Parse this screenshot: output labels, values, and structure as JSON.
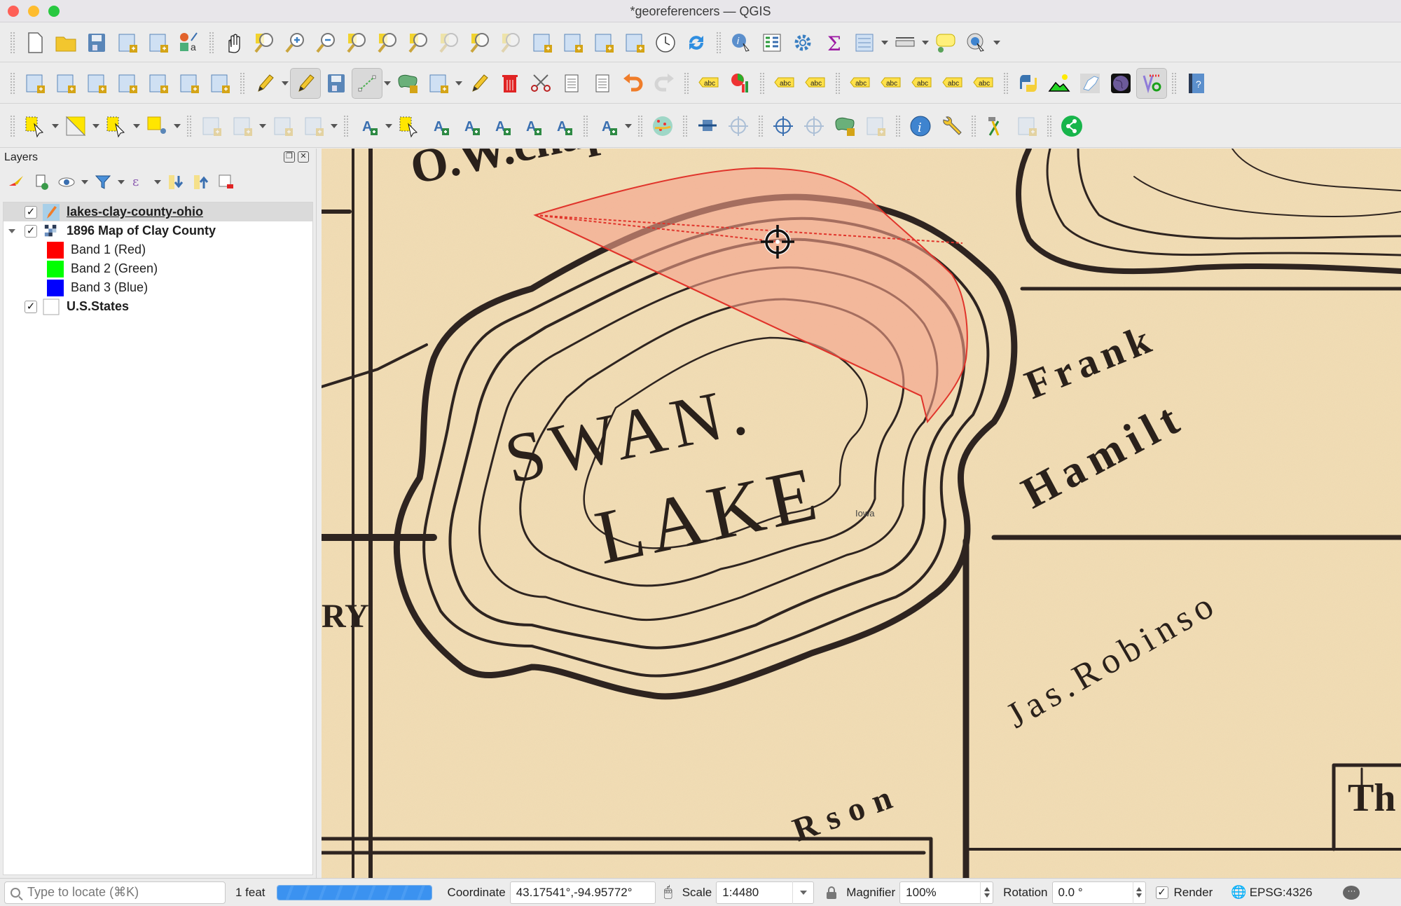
{
  "window": {
    "title": "*georeferencers — QGIS",
    "controls": [
      "close",
      "minimize",
      "maximize"
    ]
  },
  "toolbars": {
    "row1": [
      {
        "icon": "new-project-icon"
      },
      {
        "icon": "open-project-icon"
      },
      {
        "icon": "save-project-icon"
      },
      {
        "icon": "new-print-layout-icon"
      },
      {
        "icon": "layout-manager-icon"
      },
      {
        "icon": "style-manager-icon"
      },
      {
        "icon": "pan-hand-icon"
      },
      {
        "icon": "pan-to-selection-icon"
      },
      {
        "icon": "zoom-in-icon"
      },
      {
        "icon": "zoom-out-icon"
      },
      {
        "icon": "zoom-full-icon"
      },
      {
        "icon": "zoom-to-selection-icon"
      },
      {
        "icon": "zoom-to-layer-icon"
      },
      {
        "icon": "zoom-native-resolution-icon",
        "disabled": true
      },
      {
        "icon": "zoom-last-icon"
      },
      {
        "icon": "zoom-next-icon",
        "disabled": true
      },
      {
        "icon": "new-map-view-icon"
      },
      {
        "icon": "new-3d-map-view-icon"
      },
      {
        "icon": "new-spatial-bookmark-icon"
      },
      {
        "icon": "show-spatial-bookmarks-icon"
      },
      {
        "icon": "temporal-controller-icon"
      },
      {
        "icon": "refresh-icon"
      },
      {
        "icon": "identify-features-icon"
      },
      {
        "icon": "attribute-table-icon"
      },
      {
        "icon": "toolbox-gear-icon"
      },
      {
        "icon": "statistical-summary-icon"
      },
      {
        "icon": "open-field-calculator-icon"
      },
      {
        "icon": "measure-line-icon"
      },
      {
        "icon": "map-tips-icon"
      },
      {
        "icon": "run-action-icon"
      }
    ],
    "row2": [
      {
        "icon": "data-source-manager-icon"
      },
      {
        "icon": "new-geopackage-layer-icon"
      },
      {
        "icon": "new-shapefile-layer-icon"
      },
      {
        "icon": "new-spatialite-layer-icon"
      },
      {
        "icon": "new-temporary-layer-icon"
      },
      {
        "icon": "new-virtual-layer-icon"
      },
      {
        "icon": "new-mesh-layer-icon"
      },
      {
        "icon": "current-edits-icon"
      },
      {
        "icon": "toggle-editing-pencil-icon",
        "active": true
      },
      {
        "icon": "save-layer-edits-icon"
      },
      {
        "icon": "digitize-line-icon",
        "active": true
      },
      {
        "icon": "add-polygon-feature-icon"
      },
      {
        "icon": "vertex-tool-icon"
      },
      {
        "icon": "modify-attributes-icon"
      },
      {
        "icon": "delete-selected-icon"
      },
      {
        "icon": "cut-features-icon"
      },
      {
        "icon": "copy-features-icon"
      },
      {
        "icon": "paste-features-icon"
      },
      {
        "icon": "undo-icon"
      },
      {
        "icon": "redo-icon",
        "disabled": true
      },
      {
        "icon": "label-abc-icon"
      },
      {
        "icon": "diagram-options-icon"
      },
      {
        "icon": "highlight-pinned-labels-icon"
      },
      {
        "icon": "toggle-display-labels-icon"
      },
      {
        "icon": "pin-unpin-labels-icon"
      },
      {
        "icon": "show-hide-labels-icon"
      },
      {
        "icon": "move-label-icon"
      },
      {
        "icon": "rotate-label-icon"
      },
      {
        "icon": "change-label-icon"
      },
      {
        "icon": "python-console-icon"
      },
      {
        "icon": "terrain-profile-icon"
      },
      {
        "icon": "georeferencer-map-icon"
      },
      {
        "icon": "globe-dark-icon"
      },
      {
        "icon": "vertex-plugin-icon",
        "active": true
      },
      {
        "icon": "help-book-icon"
      }
    ],
    "row3": [
      {
        "icon": "select-features-icon"
      },
      {
        "icon": "select-by-polygon-icon"
      },
      {
        "icon": "deselect-features-icon"
      },
      {
        "icon": "select-by-location-icon"
      },
      {
        "icon": "advanced-digitizing-icon",
        "disabled": true
      },
      {
        "icon": "reshape-features-icon",
        "disabled": true
      },
      {
        "icon": "split-parts-icon",
        "disabled": true
      },
      {
        "icon": "offset-curve-icon",
        "disabled": true
      },
      {
        "icon": "annotation-text-icon"
      },
      {
        "icon": "select-annotation-icon"
      },
      {
        "icon": "polygon-annotation-icon"
      },
      {
        "icon": "line-annotation-icon"
      },
      {
        "icon": "marker-annotation-icon"
      },
      {
        "icon": "point-text-annotation-icon"
      },
      {
        "icon": "line-text-annotation-icon"
      },
      {
        "icon": "text-callout-icon"
      },
      {
        "icon": "globe-colored-icon"
      },
      {
        "icon": "move-feature-icon"
      },
      {
        "icon": "snapping-icon",
        "disabled": true
      },
      {
        "icon": "georeference-crosshair-icon"
      },
      {
        "icon": "add-gcp-icon",
        "disabled": true
      },
      {
        "icon": "add-feature-icon"
      },
      {
        "icon": "trace-icon",
        "disabled": true
      },
      {
        "icon": "info-icon"
      },
      {
        "icon": "wrench-settings-icon"
      },
      {
        "icon": "processing-tools-icon"
      },
      {
        "icon": "models-icon",
        "disabled": true
      },
      {
        "icon": "share-icon"
      }
    ]
  },
  "layers_panel": {
    "title": "Layers",
    "tools": [
      "open-styling-icon",
      "add-group-icon",
      "manage-visibility-icon",
      "filter-legend-icon",
      "filter-expression-icon",
      "expand-all-icon",
      "collapse-all-icon",
      "remove-layer-icon"
    ],
    "layers": [
      {
        "name": "lakes-clay-county-ohio",
        "checked": true,
        "icon": "editing-pencil-icon",
        "selected": true,
        "bold": true,
        "underline": true
      },
      {
        "name": "1896 Map of Clay County",
        "checked": true,
        "icon": "raster-icon",
        "expanded": true,
        "bold": true
      },
      {
        "name": "Band 1 (Red)",
        "swatch": "#ff0000"
      },
      {
        "name": "Band 2 (Green)",
        "swatch": "#00ff00"
      },
      {
        "name": "Band 3 (Blue)",
        "swatch": "#0000ff"
      },
      {
        "name": "U.S.States",
        "checked": true,
        "icon": "empty-polygon-icon",
        "bold": true
      }
    ]
  },
  "map": {
    "labels": {
      "owner_top": "O.W.chap mau.",
      "lake_name_1": "SWAN.",
      "lake_name_2": "LAKE",
      "frank": "Frank",
      "hamilton": "Hamilt",
      "robinson": "Jas.Robinso",
      "rson": "Rson",
      "ry": "RY",
      "th": "Th",
      "iowa": "Iowa"
    },
    "digitizing_polygon_color": "#e0342b",
    "fill_color": "#f5a08a",
    "cursor": "crosshair"
  },
  "statusbar": {
    "locator_placeholder": "Type to locate (⌘K)",
    "feature_count": "1 feat",
    "progress": 1.0,
    "coordinate_label": "Coordinate",
    "coordinate_value": "43.17541°,-94.95772°",
    "scale_label": "Scale",
    "scale_value": "1:4480",
    "magnifier_label": "Magnifier",
    "magnifier_value": "100%",
    "rotation_label": "Rotation",
    "rotation_value": "0.0 °",
    "render_label": "Render",
    "render_checked": true,
    "crs": "EPSG:4326"
  }
}
